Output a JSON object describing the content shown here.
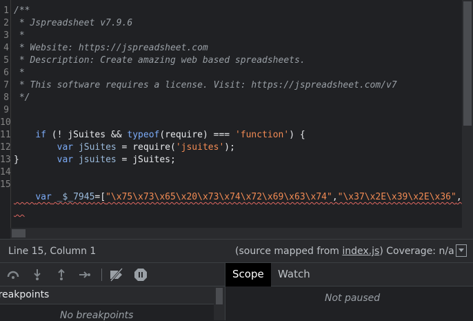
{
  "editor": {
    "line_numbers": [
      "1",
      "2",
      "3",
      "4",
      "5",
      "6",
      "7",
      "8",
      "9",
      "10",
      "11",
      "12",
      "13",
      "14",
      "15"
    ],
    "lines": {
      "l1": "/**",
      "l2": " * Jspreadsheet v7.9.6",
      "l3": " *",
      "l4": " * Website: https://jspreadsheet.com",
      "l5": " * Description: Create amazing web based spreadsheets.",
      "l6": " *",
      "l7": " * This software requires a license. Visit: https://jspreadsheet.com/v7",
      "l8": " */",
      "l10_kw_if": "if",
      "l10_a": " (! ",
      "l10_jsuites": "jSuites",
      "l10_b": " && ",
      "l10_typeof": "typeof",
      "l10_c": "(require) === ",
      "l10_str": "'function'",
      "l10_d": ") {",
      "l11_indent": "    ",
      "l11_var": "var",
      "l11_a": " ",
      "l11_jsuites": "jSuites",
      "l11_b": " = require(",
      "l11_str": "'jsuites'",
      "l11_c": ");",
      "l12_indent": "    ",
      "l12_var": "var",
      "l12_a": " ",
      "l12_jsuites": "jsuites",
      "l12_b": " = jSuites;",
      "l13": "}",
      "l15_var": "var",
      "l15_a": " ",
      "l15_name": "_$_7945",
      "l15_b": "=[",
      "l15_str1": "\"\\x75\\x73\\x65\\x20\\x73\\x74\\x72\\x69\\x63\\x74\"",
      "l15_c": ",",
      "l15_str2": "\"\\x37\\x2E\\x39\\x2E\\x36\"",
      "l15_d": ","
    }
  },
  "status": {
    "position": "Line 15, Column 1",
    "source_prefix": "(source mapped from ",
    "source_file": "index.js",
    "source_suffix": ")",
    "coverage": " Coverage: n/a"
  },
  "debugger": {
    "breakpoints_header": "Breakpoints",
    "no_breakpoints": "No breakpoints",
    "tabs": [
      "Scope",
      "Watch"
    ],
    "not_paused": "Not paused"
  },
  "colors": {
    "background": "#202124",
    "keyword": "#7cacf8",
    "string": "#f28b54",
    "comment": "#9aa0a6",
    "error_squiggle": "#e46962"
  }
}
